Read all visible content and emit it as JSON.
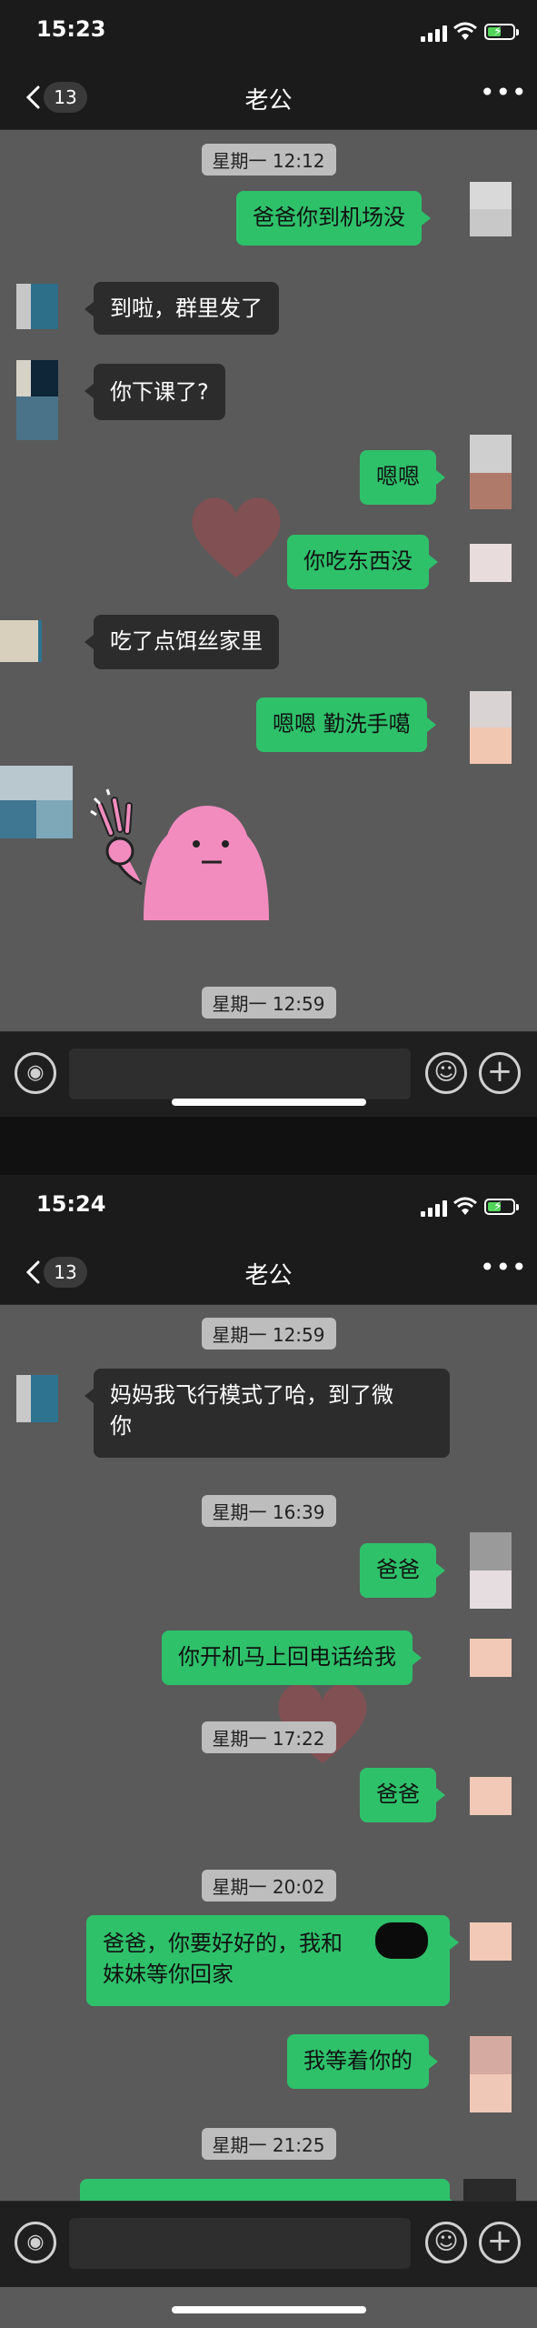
{
  "screen1": {
    "status": {
      "time": "15:23"
    },
    "nav": {
      "back_count": "13",
      "title": "老公",
      "more": "•••"
    },
    "timestamps": [
      "星期一 12:12",
      "星期一 12:59"
    ],
    "messages": [
      {
        "dir": "out",
        "text": "爸爸你到机场没"
      },
      {
        "dir": "in",
        "text": "到啦，群里发了"
      },
      {
        "dir": "in",
        "text": "你下课了?"
      },
      {
        "dir": "out",
        "text": "嗯嗯"
      },
      {
        "dir": "out",
        "text": "你吃东西没"
      },
      {
        "dir": "in",
        "text": "吃了点饵丝家里"
      },
      {
        "dir": "out",
        "text": "嗯嗯 勤洗手噶"
      }
    ]
  },
  "screen2": {
    "status": {
      "time": "15:24"
    },
    "nav": {
      "back_count": "13",
      "title": "老公",
      "more": "•••"
    },
    "timestamps": [
      "星期一 12:59",
      "星期一 16:39",
      "星期一 17:22",
      "星期一 20:02",
      "星期一 21:25"
    ],
    "messages": [
      {
        "dir": "in",
        "line1": "妈妈我飞行模式了哈，到了微",
        "line2": "你"
      },
      {
        "dir": "out",
        "text": "爸爸"
      },
      {
        "dir": "out",
        "text": "你开机马上回电话给我"
      },
      {
        "dir": "out",
        "text": "爸爸"
      },
      {
        "dir": "out",
        "line1": "爸爸，你要好好的，我和",
        "line2": "妹妹等你回家"
      },
      {
        "dir": "out",
        "text": "我等着你的"
      }
    ]
  },
  "colors": {
    "outgoing_bubble": "#2ec16a",
    "incoming_bubble": "#2c2c2c",
    "chat_bg": "#5a5a5a",
    "bar_bg": "#1b1b1b"
  },
  "icons": [
    "back-chevron-icon",
    "more-dots-icon",
    "voice-icon",
    "emoji-icon",
    "add-icon",
    "signal-icon",
    "wifi-icon",
    "battery-icon",
    "ok-sticker",
    "heart-decoration"
  ]
}
